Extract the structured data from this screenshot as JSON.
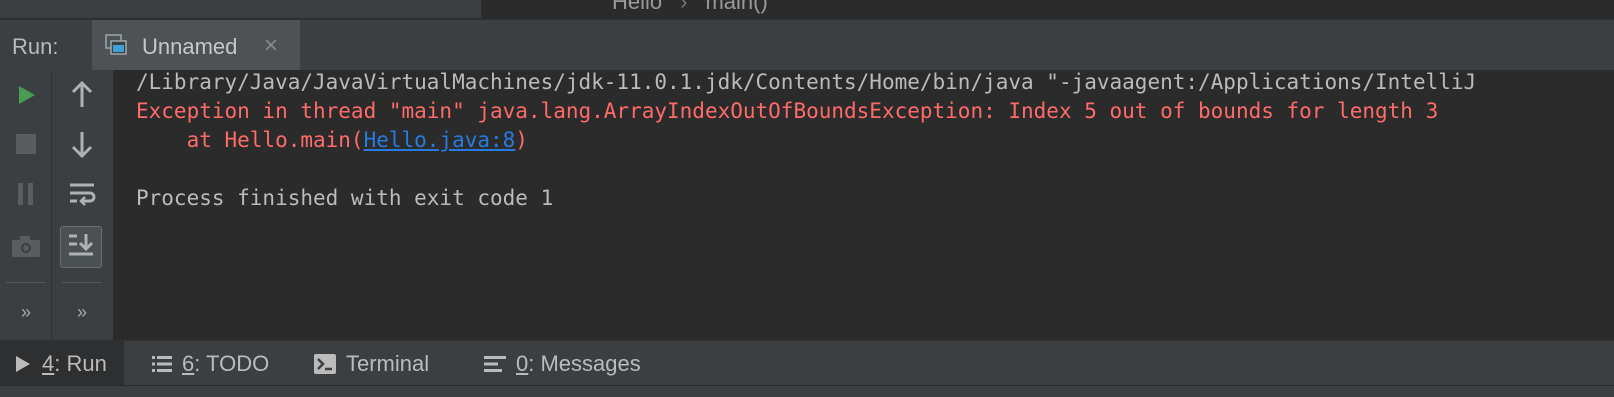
{
  "breadcrumb": {
    "items": [
      "Hello",
      "main()"
    ],
    "separator": "›"
  },
  "run_panel": {
    "label": "Run:",
    "tab": {
      "name": "Unnamed",
      "close": "×"
    }
  },
  "toolbar": {
    "left": [
      {
        "name": "rerun-icon",
        "color": "#499c54"
      },
      {
        "name": "stop-icon"
      },
      {
        "name": "pause-icon"
      },
      {
        "name": "camera-icon"
      },
      {
        "name": "more-icon",
        "text": "»"
      }
    ],
    "right": [
      {
        "name": "arrow-up-icon"
      },
      {
        "name": "arrow-down-icon"
      },
      {
        "name": "soft-wrap-icon"
      },
      {
        "name": "scroll-to-end-icon",
        "active": true
      },
      {
        "name": "more-icon",
        "text": "»"
      }
    ]
  },
  "console": {
    "line1": "/Library/Java/JavaVirtualMachines/jdk-11.0.1.jdk/Contents/Home/bin/java \"-javaagent:/Applications/IntelliJ",
    "line2": "Exception in thread \"main\" java.lang.ArrayIndexOutOfBoundsException: Index 5 out of bounds for length 3",
    "line3_prefix": "    at Hello.main(",
    "line3_link": "Hello.java:8",
    "line3_suffix": ")",
    "line5": "Process finished with exit code 1"
  },
  "colors": {
    "error": "#ff6b68",
    "link": "#287bde",
    "run_green": "#499c54"
  },
  "bottom_tabs": [
    {
      "num": "4",
      "label": ": Run",
      "active": true
    },
    {
      "num": "6",
      "label": ": TODO"
    },
    {
      "num": "",
      "label": "Terminal"
    },
    {
      "num": "0",
      "label": ": Messages"
    }
  ]
}
